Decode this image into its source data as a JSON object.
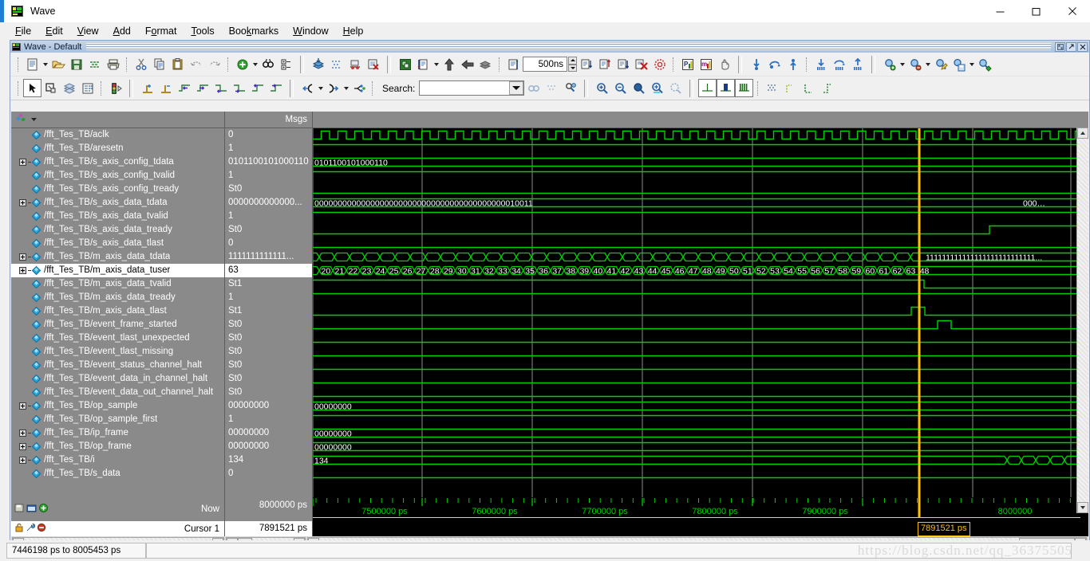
{
  "window": {
    "title": "Wave",
    "minimize": "minimize-icon",
    "maximize": "maximize-icon",
    "close": "close-icon"
  },
  "menu": [
    "File",
    "Edit",
    "View",
    "Add",
    "Format",
    "Tools",
    "Bookmarks",
    "Window",
    "Help"
  ],
  "mdi": {
    "title": "Wave - Default"
  },
  "toolbar1": [
    "new-file-icon",
    "open-folder-icon",
    "save-icon",
    "reload-icon",
    "print-icon",
    "cut-icon",
    "copy-icon",
    "paste-icon",
    "undo-icon",
    "redo-icon",
    "add-icon",
    "find-icon",
    "expand-tree-icon",
    "wave-insert-icon",
    "wave-grid-icon",
    "wave-cursor-icon",
    "wave-delete-icon",
    "simulate-icon",
    "run-length-icon",
    "run-up-icon",
    "run-back-icon",
    "run-all-icon",
    "restart-icon",
    "run-down-icon",
    "continue-run-icon",
    "step-icon",
    "break-icon",
    "compile-icon",
    "profile-icon",
    "memory-icon",
    "hand-icon",
    "insert-cursor-icon",
    "find-previous-icon",
    "find-next-icon",
    "bookmark-add-icon",
    "bookmark-prev-icon",
    "bookmark-next-icon",
    "zoom-add-icon",
    "zoom-remove-icon",
    "zoom-edit-icon",
    "zoom-save-icon",
    "zoom-apply-icon"
  ],
  "toolbar1_value": {
    "run_length": "500ns"
  },
  "toolbar2": [
    "pointer-icon",
    "zoom-select-icon",
    "waveform-icon",
    "properties-icon",
    "stop-light-icon",
    "cursor-add-icon",
    "cursor-delete-icon",
    "prev-transition-icon",
    "next-transition-icon",
    "prev-falling-icon",
    "next-falling-icon",
    "prev-rising-icon",
    "next-rising-icon",
    "expand-left-icon",
    "collapse-icon",
    "expand-all-icon",
    "search-prev-icon",
    "search-next-icon",
    "search-config-icon",
    "zoom-in-icon",
    "zoom-out-icon",
    "zoom-full-icon",
    "zoom-cursor-icon",
    "zoom-range-icon",
    "grid-single-icon",
    "grid-group-icon",
    "grid-all-icon",
    "mosaic-icon",
    "wave-style1-icon",
    "wave-style2-icon",
    "wave-style3-icon"
  ],
  "search": {
    "label": "Search:",
    "value": "",
    "placeholder": ""
  },
  "wave": {
    "name_header_icon": "signal-icon",
    "msgs_header": "Msgs",
    "signals": [
      {
        "name": "/fft_Tes_TB/aclk",
        "value": "0",
        "expandable": false
      },
      {
        "name": "/fft_Tes_TB/aresetn",
        "value": "1",
        "expandable": false
      },
      {
        "name": "/fft_Tes_TB/s_axis_config_tdata",
        "value": "0101100101000110",
        "expandable": true
      },
      {
        "name": "/fft_Tes_TB/s_axis_config_tvalid",
        "value": "1",
        "expandable": false
      },
      {
        "name": "/fft_Tes_TB/s_axis_config_tready",
        "value": "St0",
        "expandable": false
      },
      {
        "name": "/fft_Tes_TB/s_axis_data_tdata",
        "value": "0000000000000...",
        "expandable": true
      },
      {
        "name": "/fft_Tes_TB/s_axis_data_tvalid",
        "value": "1",
        "expandable": false
      },
      {
        "name": "/fft_Tes_TB/s_axis_data_tready",
        "value": "St0",
        "expandable": false
      },
      {
        "name": "/fft_Tes_TB/s_axis_data_tlast",
        "value": "0",
        "expandable": false
      },
      {
        "name": "/fft_Tes_TB/m_axis_data_tdata",
        "value": "1111111111111...",
        "expandable": true
      },
      {
        "name": "/fft_Tes_TB/m_axis_data_tuser",
        "value": "63",
        "expandable": true,
        "selected": true
      },
      {
        "name": "/fft_Tes_TB/m_axis_data_tvalid",
        "value": "St1",
        "expandable": false
      },
      {
        "name": "/fft_Tes_TB/m_axis_data_tready",
        "value": "1",
        "expandable": false
      },
      {
        "name": "/fft_Tes_TB/m_axis_data_tlast",
        "value": "St1",
        "expandable": false
      },
      {
        "name": "/fft_Tes_TB/event_frame_started",
        "value": "St0",
        "expandable": false
      },
      {
        "name": "/fft_Tes_TB/event_tlast_unexpected",
        "value": "St0",
        "expandable": false
      },
      {
        "name": "/fft_Tes_TB/event_tlast_missing",
        "value": "St0",
        "expandable": false
      },
      {
        "name": "/fft_Tes_TB/event_status_channel_halt",
        "value": "St0",
        "expandable": false
      },
      {
        "name": "/fft_Tes_TB/event_data_in_channel_halt",
        "value": "St0",
        "expandable": false
      },
      {
        "name": "/fft_Tes_TB/event_data_out_channel_halt",
        "value": "St0",
        "expandable": false
      },
      {
        "name": "/fft_Tes_TB/op_sample",
        "value": "00000000",
        "expandable": true
      },
      {
        "name": "/fft_Tes_TB/op_sample_first",
        "value": "1",
        "expandable": false
      },
      {
        "name": "/fft_Tes_TB/ip_frame",
        "value": "00000000",
        "expandable": true
      },
      {
        "name": "/fft_Tes_TB/op_frame",
        "value": "00000000",
        "expandable": true
      },
      {
        "name": "/fft_Tes_TB/i",
        "value": "134",
        "expandable": true
      },
      {
        "name": "/fft_Tes_TB/s_data",
        "value": "0",
        "expandable": false
      }
    ],
    "now": {
      "label": "Now",
      "value": "8000000 ps"
    },
    "cursor": {
      "label": "Cursor 1",
      "value": "7891521 ps"
    },
    "cursor_marker": "7891521 ps",
    "timeline_ticks": [
      "7500000 ps",
      "7600000 ps",
      "7700000 ps",
      "7800000 ps",
      "7900000 ps",
      "8000000"
    ]
  },
  "wave_render": {
    "bus_labels": {
      "s_axis_config_tdata": "0101100101000110",
      "s_axis_data_tdata": "00000000000000000000000000000000000000000010011",
      "m_axis_data_tdata_right": "111111111111111111111111111...",
      "op_sample": "00000000",
      "ip_frame": "00000000",
      "op_frame": "00000000",
      "i": "134"
    },
    "tuser_sequence": [
      "20",
      "21",
      "22",
      "23",
      "24",
      "25",
      "26",
      "27",
      "28",
      "29",
      "30",
      "31",
      "32",
      "33",
      "34",
      "35",
      "36",
      "37",
      "38",
      "39",
      "40",
      "41",
      "42",
      "43",
      "44",
      "45",
      "46",
      "47",
      "48",
      "49",
      "50",
      "51",
      "52",
      "53",
      "54",
      "55",
      "56",
      "57",
      "58",
      "59",
      "60",
      "61",
      "62",
      "63",
      "48"
    ],
    "colors": {
      "wave_green": "#00d000",
      "bus_text": "#ffffff",
      "background": "#000000",
      "cursor_yellow": "#ffc000",
      "grid_gray": "#9a9a9a"
    }
  },
  "statusbar": {
    "range": "7446198 ps to 8005453 ps"
  },
  "watermark": "https://blog.csdn.net/qq_36375505"
}
